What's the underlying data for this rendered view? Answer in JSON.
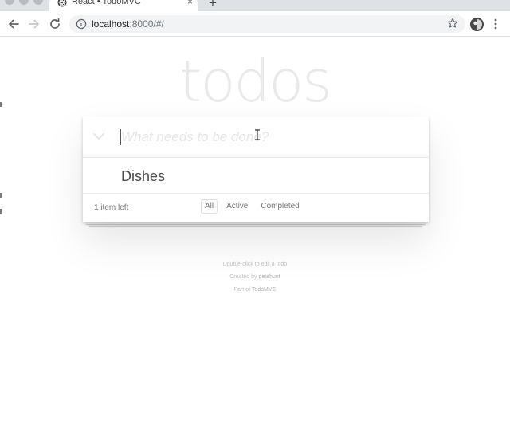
{
  "browser": {
    "tab_title": "React • TodoMVC",
    "tab_close": "×",
    "new_tab": "+",
    "url_host": "localhost",
    "url_path": ":8000/#/"
  },
  "app": {
    "title": "todos",
    "new_todo_placeholder": "What needs to be done?",
    "todos": [
      {
        "label": "Dishes",
        "completed": false
      }
    ],
    "count_text": "1 item left",
    "filters": [
      {
        "label": "All",
        "selected": true
      },
      {
        "label": "Active",
        "selected": false
      },
      {
        "label": "Completed",
        "selected": false
      }
    ]
  },
  "info": {
    "line1": "Double-click to edit a todo",
    "line2_prefix": "Created by ",
    "line2_author": "petehunt",
    "line3_prefix": "Part of ",
    "line3_link": "TodoMVC"
  },
  "colors": {
    "title": "#e9e9e9",
    "accent_border": "#e2dcdc",
    "text": "#4d4d4d"
  },
  "icons": {
    "favicon": "react-logo-icon",
    "back": "back-arrow-icon",
    "forward": "forward-arrow-icon",
    "reload": "reload-icon",
    "info": "info-icon",
    "bookmark": "star-icon",
    "profile": "profile-avatar-icon",
    "menu": "kebab-menu-icon",
    "toggle_all": "chevron-down-icon",
    "cursor": "text-cursor-icon"
  }
}
